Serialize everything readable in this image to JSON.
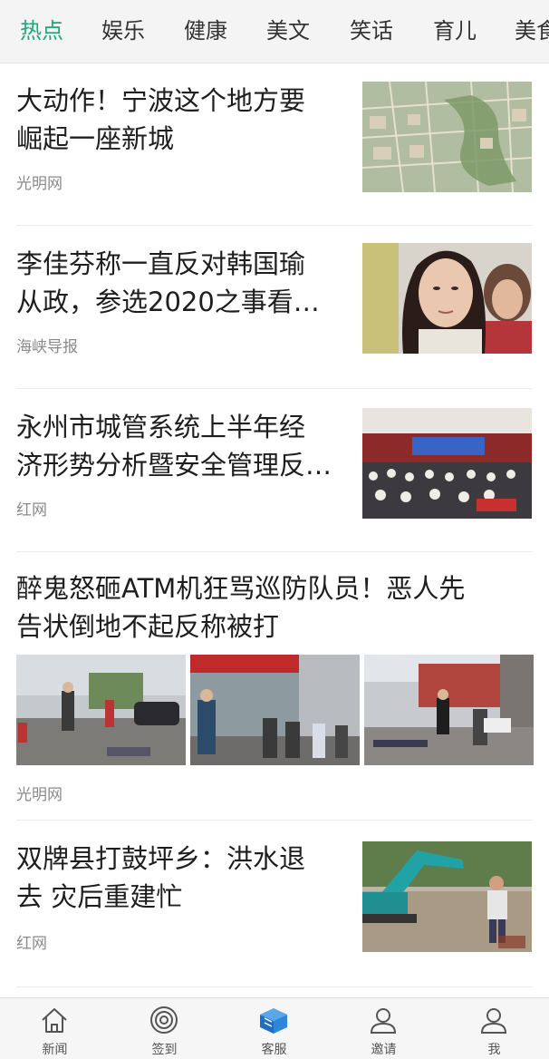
{
  "tabs": [
    {
      "label": "热点",
      "active": true
    },
    {
      "label": "娱乐",
      "active": false
    },
    {
      "label": "健康",
      "active": false
    },
    {
      "label": "美文",
      "active": false
    },
    {
      "label": "笑话",
      "active": false
    },
    {
      "label": "育儿",
      "active": false
    },
    {
      "label": "美食",
      "active": false
    }
  ],
  "accent_color": "#1fa67a",
  "feed": [
    {
      "title_line1": "大动作！宁波这个地方要",
      "title_line2": "崛起一座新城",
      "source": "光明网",
      "thumb": "city-planning-map-image"
    },
    {
      "title_line1": "李佳芬称一直反对韩国瑜",
      "title_line2": "从政，参选2020之事看…",
      "source": "海峡导报",
      "thumb": "woman-portrait-image"
    },
    {
      "title_line1": "永州市城管系统上半年经",
      "title_line2": "济形势分析暨安全管理反…",
      "source": "红网",
      "thumb": "conference-hall-image"
    },
    {
      "title_line1": "醉鬼怒砸ATM机狂骂巡防队员！恶人先",
      "title_line2": "告状倒地不起反称被打",
      "source": "光明网",
      "thumb": "street-scene-images"
    },
    {
      "title_line1": "双牌县打鼓坪乡：洪水退",
      "title_line2": "去 灾后重建忙",
      "source": "红网",
      "thumb": "excavator-flood-image"
    }
  ],
  "bottom_nav": [
    {
      "label": "新闻",
      "icon": "house-icon"
    },
    {
      "label": "签到",
      "icon": "target-icon"
    },
    {
      "label": "客服",
      "icon": "cube-icon"
    },
    {
      "label": "邀请",
      "icon": "person-icon"
    },
    {
      "label": "我",
      "icon": "user-icon"
    }
  ]
}
